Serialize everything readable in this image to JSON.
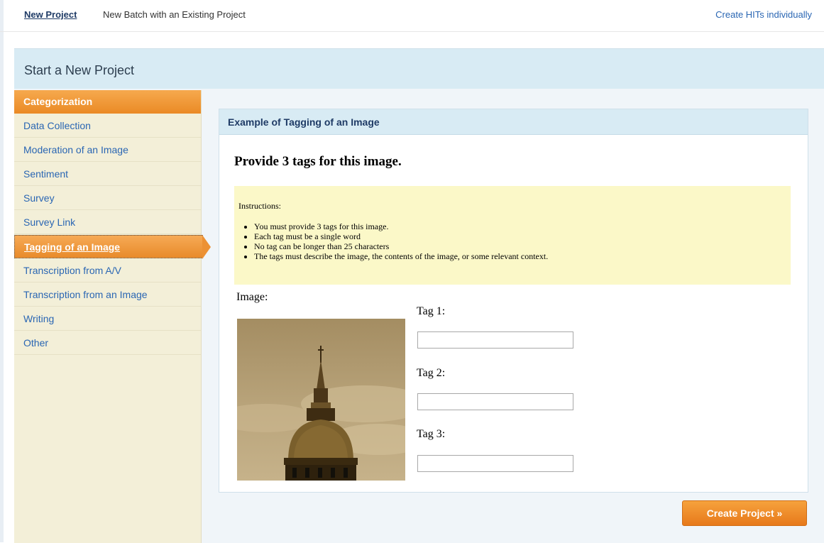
{
  "nav": {
    "new_project": "New Project",
    "new_batch": "New Batch with an Existing Project",
    "create_hits": "Create HITs individually"
  },
  "panel": {
    "title": "Start a New Project"
  },
  "sidebar": {
    "category": "Categorization",
    "items": [
      "Data Collection",
      "Moderation of an Image",
      "Sentiment",
      "Survey",
      "Survey Link",
      "Tagging of an Image",
      "Transcription from A/V",
      "Transcription from an Image",
      "Writing",
      "Other"
    ],
    "selected": "Tagging of an Image"
  },
  "example": {
    "header": "Example of Tagging of an Image",
    "question": "Provide 3 tags for this image.",
    "instructions_label": "Instructions:",
    "instructions": [
      "You must provide 3 tags for this image.",
      "Each tag must be a single word",
      "No tag can be longer than 25 characters",
      "The tags must describe the image, the contents of the image, or some relevant context."
    ],
    "image_label": "Image:",
    "tags": [
      {
        "label": "Tag 1:",
        "value": ""
      },
      {
        "label": "Tag 2:",
        "value": ""
      },
      {
        "label": "Tag 3:",
        "value": ""
      }
    ]
  },
  "actions": {
    "create_project": "Create Project »"
  },
  "colors": {
    "accent_orange": "#ec8a2b",
    "header_blue": "#d8ebf4",
    "sidebar_bg": "#f3efd8",
    "instructions_bg": "#fbf8c8",
    "link_blue": "#2a66b3"
  }
}
